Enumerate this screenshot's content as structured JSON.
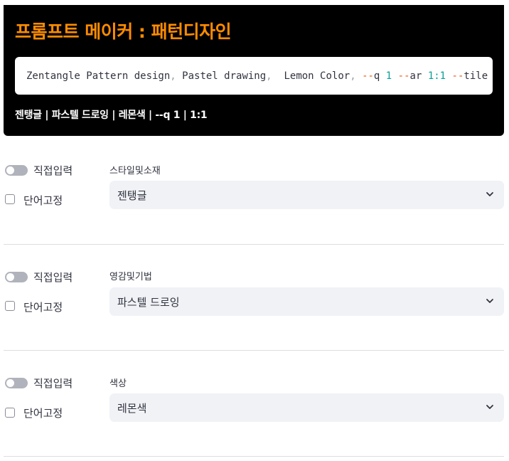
{
  "header": {
    "title": "프롬프트 메이커 : 패턴디자인",
    "prompt_tokens": [
      {
        "text": "Zentangle Pattern design",
        "kind": "text"
      },
      {
        "text": ",",
        "kind": "punct"
      },
      {
        "text": " Pastel drawing",
        "kind": "text"
      },
      {
        "text": ",",
        "kind": "punct"
      },
      {
        "text": "  Lemon Color",
        "kind": "text"
      },
      {
        "text": ",",
        "kind": "punct"
      },
      {
        "text": " ",
        "kind": "text"
      },
      {
        "text": "--",
        "kind": "flag"
      },
      {
        "text": "q ",
        "kind": "text"
      },
      {
        "text": "1",
        "kind": "num"
      },
      {
        "text": " ",
        "kind": "text"
      },
      {
        "text": "--",
        "kind": "flag"
      },
      {
        "text": "ar ",
        "kind": "text"
      },
      {
        "text": "1:1",
        "kind": "num"
      },
      {
        "text": " ",
        "kind": "text"
      },
      {
        "text": "--",
        "kind": "flag"
      },
      {
        "text": "tile",
        "kind": "text"
      }
    ],
    "summary": "젠탱글 | 파스텔 드로잉 | 레몬색 | --q 1 | 1:1"
  },
  "sections": [
    {
      "toggle_label": "직접입력",
      "checkbox_label": "단어고정",
      "field_label": "스타일및소재",
      "selected": "젠탱글"
    },
    {
      "toggle_label": "직접입력",
      "checkbox_label": "단어고정",
      "field_label": "영감및기법",
      "selected": "파스텔 드로잉"
    },
    {
      "toggle_label": "직접입력",
      "checkbox_label": "단어고정",
      "field_label": "색상",
      "selected": "레몬색"
    }
  ],
  "colors": {
    "title": "#ff8c00",
    "header_bg": "#000000",
    "select_bg": "#f0f2f6",
    "flag": "#e8590c",
    "number": "#099f96"
  }
}
